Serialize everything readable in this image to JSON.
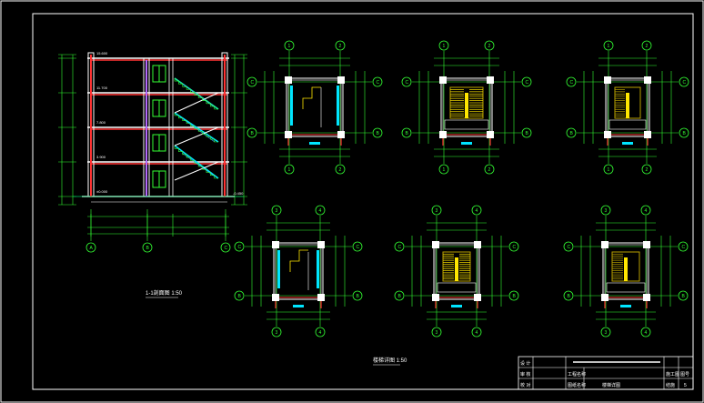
{
  "colors": {
    "background": "#000000",
    "frame": "#ffffff",
    "dimension": "#33ff33",
    "wall": "#ffffff",
    "column_cyan": "#00e5ff",
    "beam_red": "#ff3333",
    "stair_yellow": "#ffe600",
    "stair_olive": "#b8a000",
    "handrail": "#3fa9ff",
    "window_green": "#33ff33",
    "ground_line": "#00cc66"
  },
  "captions": {
    "section_title": "1-1剖面图 1:50",
    "plans_title": "楼梯详图 1:50"
  },
  "grid_axes": {
    "section_bottom": [
      "A",
      "B",
      "C"
    ],
    "plan_vertical_upper": [
      "1",
      "2"
    ],
    "plan_vertical_lower": [
      "3",
      "4"
    ],
    "plan_horizontal": [
      "B",
      "C"
    ]
  },
  "levels": [
    "15.600",
    "11.700",
    "7.800",
    "3.900",
    "±0.000",
    "-0.450"
  ],
  "title_block": {
    "row1": [
      "设 计",
      "",
      "",
      ""
    ],
    "row2": [
      "审 核",
      "工程名称",
      "",
      "施工图"
    ],
    "row3": [
      "校 对",
      "图纸名称",
      "楼梯详图",
      "结施"
    ],
    "sheet_label": "图号",
    "sheet_no": "5"
  }
}
